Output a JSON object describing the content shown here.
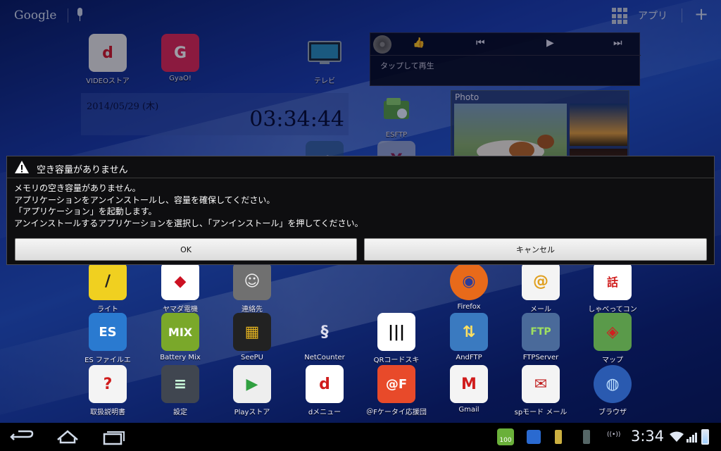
{
  "topbar": {
    "search_label": "Google",
    "apps_label": "アプリ"
  },
  "apps_upper": [
    {
      "name": "app-videostore",
      "label": "VIDEOストア",
      "bg": "#eaeaea",
      "fg": "#d21a2c",
      "glyph": "d"
    },
    {
      "name": "app-gyao",
      "label": "GyaO!",
      "bg": "#e02a5a",
      "fg": "#ffffff",
      "glyph": "G"
    },
    {
      "name": "app-tv",
      "label": "テレビ",
      "bg": "#223344",
      "fg": "#7fd0ff",
      "glyph": "▭"
    }
  ],
  "esftp": {
    "label": "ESFTP"
  },
  "clock_widget": {
    "date": "2014/05/29 (木)",
    "time": "03:34:44"
  },
  "music_widget": {
    "play_hint": "タップして再生"
  },
  "photo_widget": {
    "title": "Photo"
  },
  "dialog": {
    "title": "空き容量がありません",
    "lines": [
      "メモリの空き容量がありません。",
      "アプリケーションをアンインストールし、容量を確保してください。",
      "「アプリケーション」を起動します。",
      "アンインストールするアプリケーションを選択し、「アンインストール」を押してください。"
    ],
    "ok_label": "OK",
    "cancel_label": "キャンセル"
  },
  "row_a": [
    {
      "name": "app-light",
      "label": "ライト",
      "bg": "#f0d020",
      "fg": "#222",
      "glyph": "/"
    },
    {
      "name": "app-yamato",
      "label": "ヤマダ電機",
      "bg": "#ffffff",
      "fg": "#cc1122",
      "glyph": "◆"
    },
    {
      "name": "app-contacts",
      "label": "連絡先",
      "bg": "#707070",
      "fg": "#eee",
      "glyph": "☺"
    },
    {
      "name": "app-firefox",
      "label": "Firefox",
      "bg": "#e86a1a",
      "fg": "#2a3c9a",
      "glyph": "◉"
    },
    {
      "name": "app-mail",
      "label": "メール",
      "bg": "#f4f4f4",
      "fg": "#e0a020",
      "glyph": "@"
    },
    {
      "name": "app-shabette",
      "label": "しゃべってコン",
      "bg": "#ffffff",
      "fg": "#d01c1c",
      "glyph": "話"
    }
  ],
  "row_b": [
    {
      "name": "app-es-file",
      "label": "ES ファイルエ",
      "bg": "#2a7ad0",
      "fg": "#fff",
      "glyph": "ES"
    },
    {
      "name": "app-battery-mix",
      "label": "Battery Mix",
      "bg": "#7aa82a",
      "fg": "#fff",
      "glyph": "MIX"
    },
    {
      "name": "app-seepu",
      "label": "SeePU",
      "bg": "#222222",
      "fg": "#e0b020",
      "glyph": "▦"
    },
    {
      "name": "app-netcounter",
      "label": "NetCounter",
      "bg": "#dddddd",
      "fg": "#333",
      "glyph": "§"
    },
    {
      "name": "app-qr",
      "label": "QRコードスキ",
      "bg": "#ffffff",
      "fg": "#000",
      "glyph": "|||"
    },
    {
      "name": "app-andftp",
      "label": "AndFTP",
      "bg": "#3a7ac0",
      "fg": "#ffe060",
      "glyph": "⇅"
    },
    {
      "name": "app-ftpserver",
      "label": "FTPServer",
      "bg": "#4a6a9a",
      "fg": "#9fe060",
      "glyph": "FTP"
    },
    {
      "name": "app-maps",
      "label": "マップ",
      "bg": "#5a9a4a",
      "fg": "#d02020",
      "glyph": "◈"
    }
  ],
  "row_c": [
    {
      "name": "app-manual",
      "label": "取扱説明書",
      "bg": "#f4f4f4",
      "fg": "#d01c1c",
      "glyph": "?"
    },
    {
      "name": "app-settings",
      "label": "設定",
      "bg": "#404650",
      "fg": "#cfd",
      "glyph": "≡"
    },
    {
      "name": "app-playstore",
      "label": "Playストア",
      "bg": "#eeeeee",
      "fg": "#30a040",
      "glyph": "▶"
    },
    {
      "name": "app-dmenu",
      "label": "dメニュー",
      "bg": "#ffffff",
      "fg": "#d01c1c",
      "glyph": "d"
    },
    {
      "name": "app-at-f",
      "label": "＠Fケータイ応援団",
      "bg": "#e84a2a",
      "fg": "#fff",
      "glyph": "@F"
    },
    {
      "name": "app-gmail",
      "label": "Gmail",
      "bg": "#f4f4f4",
      "fg": "#d01c1c",
      "glyph": "M"
    },
    {
      "name": "app-spmail",
      "label": "spモード メール",
      "bg": "#f4f4f4",
      "fg": "#c02020",
      "glyph": "✉"
    },
    {
      "name": "app-browser",
      "label": "ブラウザ",
      "bg": "#2a5ab0",
      "fg": "#bfe0ff",
      "glyph": "◍"
    }
  ],
  "statusbar": {
    "time": "3:34",
    "battery_app_value": "100"
  }
}
